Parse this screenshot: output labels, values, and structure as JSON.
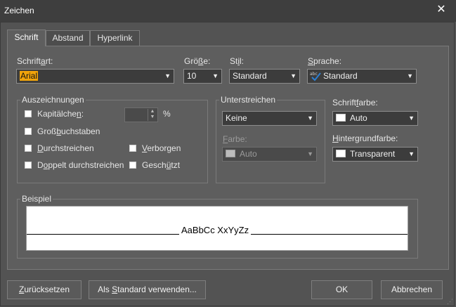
{
  "window": {
    "title": "Zeichen"
  },
  "tabs": [
    {
      "label": "Schrift",
      "active": true
    },
    {
      "label": "Abstand",
      "active": false
    },
    {
      "label": "Hyperlink",
      "active": false
    }
  ],
  "font": {
    "label_pre": "Schrift",
    "label_key": "a",
    "label_post": "rt:",
    "value": "Arial"
  },
  "size": {
    "label_pre": "Grö",
    "label_key": "ß",
    "label_post": "e:",
    "value": "10"
  },
  "style": {
    "label_pre": "St",
    "label_key": "i",
    "label_post": "l:",
    "value": "Standard"
  },
  "language": {
    "label_pre": "",
    "label_key": "S",
    "label_post": "prache:",
    "value": "Standard",
    "icon": "spellcheck-icon"
  },
  "effects": {
    "legend": "Auszeichnungen",
    "smallcaps": {
      "pre": "Kapitälche",
      "key": "n",
      "post": ":",
      "checked": false
    },
    "smallcaps_unit": "%",
    "uppercase": {
      "pre": "Groß",
      "key": "b",
      "post": "uchstaben",
      "checked": false
    },
    "strikethrough": {
      "pre": "",
      "key": "D",
      "post": "urchstreichen",
      "checked": false
    },
    "double_strikethrough": {
      "pre": "D",
      "key": "o",
      "post": "ppelt durchstreichen",
      "checked": false
    },
    "hidden": {
      "pre": "",
      "key": "V",
      "post": "erborgen",
      "checked": false
    },
    "protected": {
      "pre": "Gesch",
      "key": "ü",
      "post": "tzt",
      "checked": false
    }
  },
  "underline": {
    "legend": "Unterstreichen",
    "value": "Keine",
    "color_label_pre": "",
    "color_label_key": "F",
    "color_label_post": "arbe:",
    "color_value": "Auto"
  },
  "font_color": {
    "label_pre": "Schrift",
    "label_key": "f",
    "label_post": "arbe:",
    "value": "Auto",
    "swatch": "#ffffff"
  },
  "background_color": {
    "label_pre": "",
    "label_key": "H",
    "label_post": "intergrundfarbe:",
    "value": "Transparent",
    "swatch": "#ffffff"
  },
  "preview": {
    "legend": "Beispiel",
    "sample": "AaBbCc XxYyZz"
  },
  "buttons": {
    "reset_pre": "",
    "reset_key": "Z",
    "reset_post": "urücksetzen",
    "set_default_pre": "Als ",
    "set_default_key": "S",
    "set_default_post": "tandard verwenden...",
    "ok": "OK",
    "cancel": "Abbrechen"
  },
  "colors": {
    "dialog_bg": "#5e5e5e",
    "title_bg": "#3e3e3e",
    "selection": "#f0a30a",
    "check_accent": "#2d7fd3"
  }
}
